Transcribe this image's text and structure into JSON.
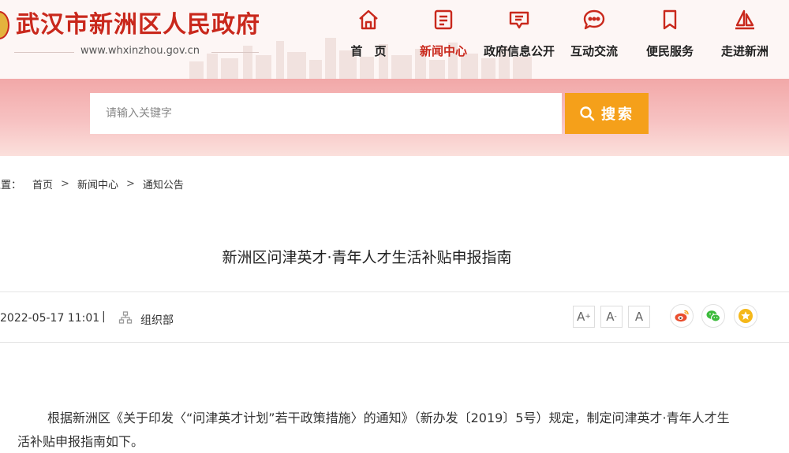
{
  "header": {
    "site_title": "武汉市新洲区人民政府",
    "site_url": "www.whxinzhou.gov.cn",
    "brand_color": "#c9281c"
  },
  "nav": {
    "items": [
      {
        "label": "首　页",
        "icon": "home-icon"
      },
      {
        "label": "新闻中心",
        "icon": "news-icon",
        "active": true
      },
      {
        "label": "政府信息公开",
        "icon": "info-disclosure-icon"
      },
      {
        "label": "互动交流",
        "icon": "chat-icon"
      },
      {
        "label": "便民服务",
        "icon": "bookmark-icon"
      },
      {
        "label": "走进新洲",
        "icon": "sail-icon"
      }
    ]
  },
  "search": {
    "placeholder": "请输入关键字",
    "button_label": "搜索",
    "button_color": "#f5a01a"
  },
  "breadcrumb": {
    "prefix": "位置：",
    "items": [
      "首页",
      "新闻中心",
      "通知公告"
    ],
    "separator": ">"
  },
  "article": {
    "title": "新洲区问津英才·青年人才生活补贴申报指南",
    "date": "2022-05-17 11:01",
    "divider": "|",
    "department": "组织部",
    "font_sizes": [
      "A",
      "A",
      "A"
    ],
    "share": [
      "weibo-icon",
      "wechat-icon",
      "favorite-icon"
    ],
    "body": "根据新洲区《关于印发〈“问津英才计划”若干政策措施〉的通知》（新办发〔2019〕5号）规定，制定问津英才·青年人才生活补贴申报指南如下。"
  }
}
